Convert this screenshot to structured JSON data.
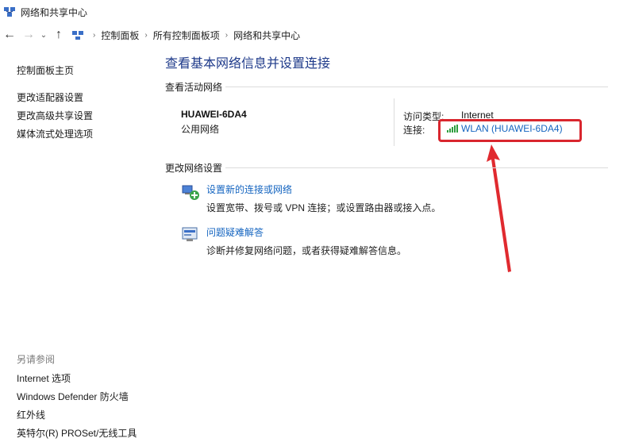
{
  "window": {
    "title": "网络和共享中心"
  },
  "breadcrumbs": [
    "控制面板",
    "所有控制面板项",
    "网络和共享中心"
  ],
  "sidebar": {
    "home": "控制面板主页",
    "links": [
      "更改适配器设置",
      "更改高级共享设置",
      "媒体流式处理选项"
    ],
    "see_also_title": "另请参阅",
    "see_also": [
      "Internet 选项",
      "Windows Defender 防火墙",
      "红外线",
      "英特尔(R) PROSet/无线工具"
    ]
  },
  "main": {
    "title": "查看基本网络信息并设置连接",
    "active_networks_label": "查看活动网络",
    "network": {
      "name": "HUAWEI-6DA4",
      "category": "公用网络",
      "access_type_label": "访问类型:",
      "access_type": "Internet",
      "connection_label": "连接:",
      "connection": "WLAN (HUAWEI-6DA4)"
    },
    "change_settings_label": "更改网络设置",
    "tasks": [
      {
        "link": "设置新的连接或网络",
        "desc": "设置宽带、拨号或 VPN 连接；或设置路由器或接入点。",
        "icon": "new-connection-icon"
      },
      {
        "link": "问题疑难解答",
        "desc": "诊断并修复网络问题，或者获得疑难解答信息。",
        "icon": "troubleshoot-icon"
      }
    ]
  },
  "colors": {
    "link": "#1565c0",
    "title": "#1e3a8a",
    "annotation": "#d9262e"
  }
}
